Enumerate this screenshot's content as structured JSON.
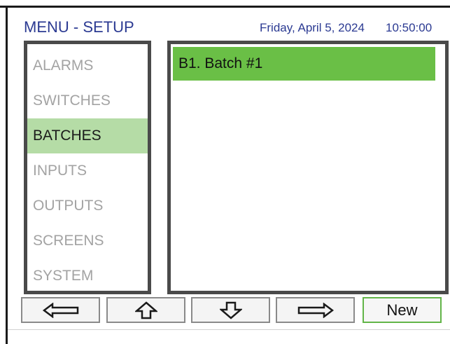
{
  "header": {
    "title": "MENU - SETUP",
    "date": "Friday, April 5, 2024",
    "time": "10:50:00"
  },
  "menu": {
    "items": [
      {
        "label": "ALARMS",
        "selected": false
      },
      {
        "label": "SWITCHES",
        "selected": false
      },
      {
        "label": "BATCHES",
        "selected": true
      },
      {
        "label": "INPUTS",
        "selected": false
      },
      {
        "label": "OUTPUTS",
        "selected": false
      },
      {
        "label": "SCREENS",
        "selected": false
      },
      {
        "label": "SYSTEM",
        "selected": false
      }
    ]
  },
  "list": {
    "rows": [
      {
        "label": "B1. Batch #1",
        "selected": true
      }
    ]
  },
  "toolbar": {
    "left_icon": "arrow-left-icon",
    "up_icon": "arrow-up-icon",
    "down_icon": "arrow-down-icon",
    "right_icon": "arrow-right-icon",
    "new_label": "New"
  },
  "colors": {
    "header_text": "#2b3a92",
    "selected_menu_bg": "#b5dca6",
    "selected_row_bg": "#6abf46",
    "panel_border": "#4a4a4a",
    "inactive_text": "#a3a3a3",
    "new_button_border": "#62b548"
  }
}
